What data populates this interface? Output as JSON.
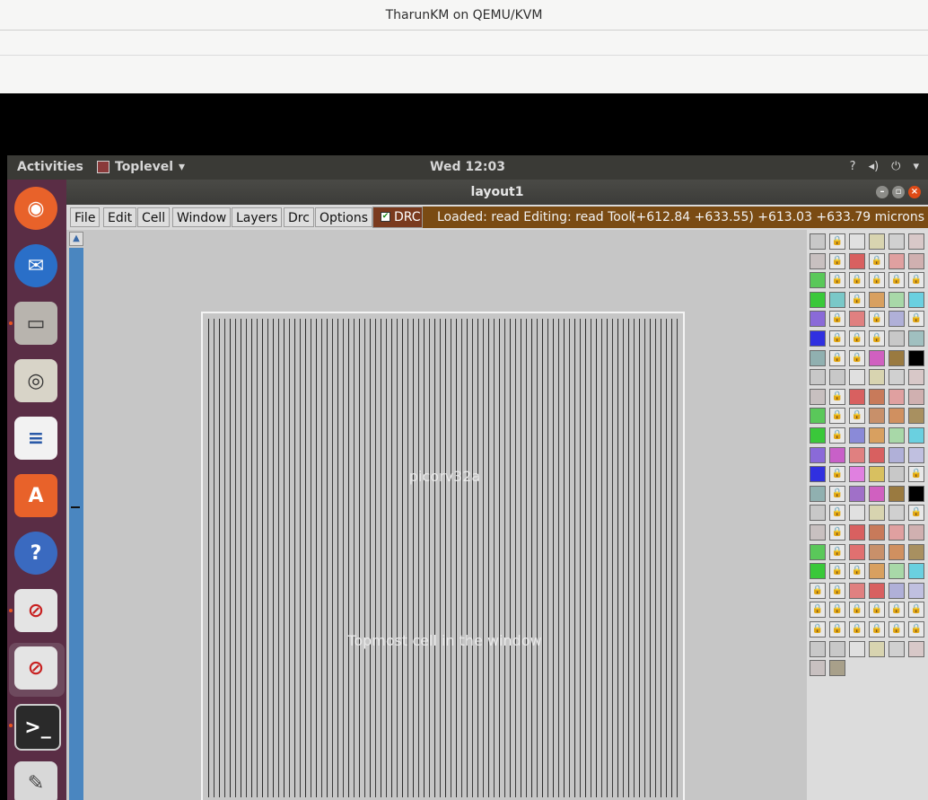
{
  "host": {
    "title": "TharunKM on QEMU/KVM"
  },
  "topbar": {
    "activities": "Activities",
    "app_menu": "Toplevel",
    "clock": "Wed 12:03"
  },
  "dock": {
    "items": [
      "firefox-icon",
      "thunderbird-icon",
      "files-icon",
      "rhythmbox-icon",
      "writer-icon",
      "software-icon",
      "help-icon",
      "magic-icon",
      "magic-icon",
      "terminal-icon",
      "editor-icon"
    ]
  },
  "window": {
    "title": "layout1",
    "menu": [
      "File",
      "Edit",
      "Cell",
      "Window",
      "Layers",
      "Drc",
      "Options"
    ],
    "drc_label": "DRC",
    "status_message": "Loaded: read Editing: read Tool: bo",
    "coords": "(+612.84 +633.55) +613.03 +633.79 microns"
  },
  "canvas": {
    "cell_name": "picorv32a",
    "cell_desc": "Topmost cell in the window"
  },
  "colors": {
    "accent_drc": "#7a3a1e",
    "status_bg": "#7a4b13",
    "dock_bg": "#5a2d45"
  }
}
